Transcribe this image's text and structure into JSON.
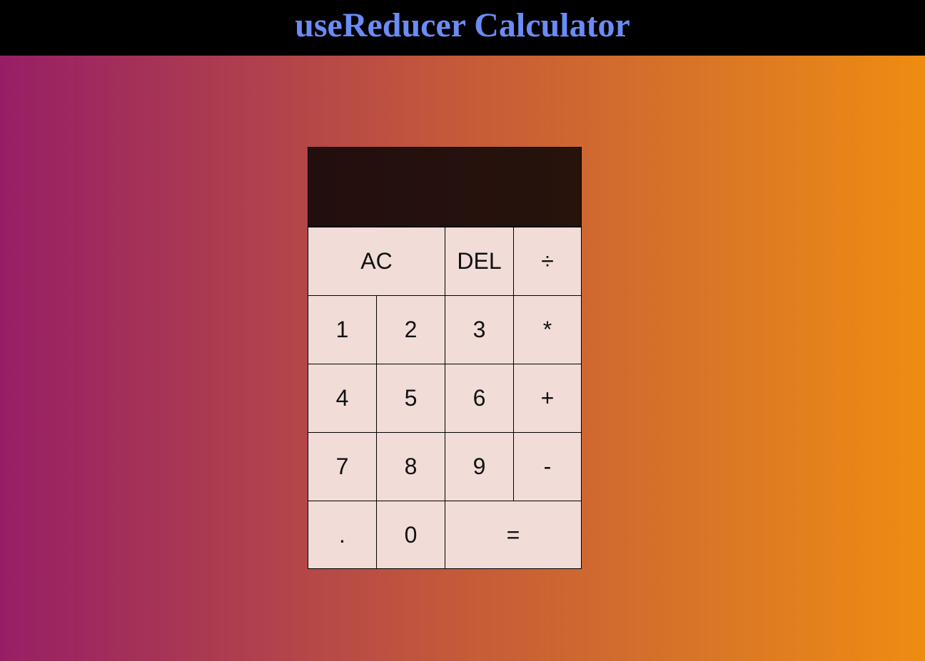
{
  "header": {
    "title": "useReducer Calculator",
    "title_color": "#6b8cf5",
    "background_color": "#000000"
  },
  "display": {
    "previous_operand": "",
    "current_operand": ""
  },
  "keys": {
    "clear": "AC",
    "delete": "DEL",
    "divide": "÷",
    "one": "1",
    "two": "2",
    "three": "3",
    "multiply": "*",
    "four": "4",
    "five": "5",
    "six": "6",
    "add": "+",
    "seven": "7",
    "eight": "8",
    "nine": "9",
    "subtract": "-",
    "decimal": ".",
    "zero": "0",
    "equals": "="
  },
  "colors": {
    "gradient_start": "#971e66",
    "gradient_end": "#ee8c12",
    "display_background": "#25100e",
    "key_background": "#f1dcd8"
  }
}
